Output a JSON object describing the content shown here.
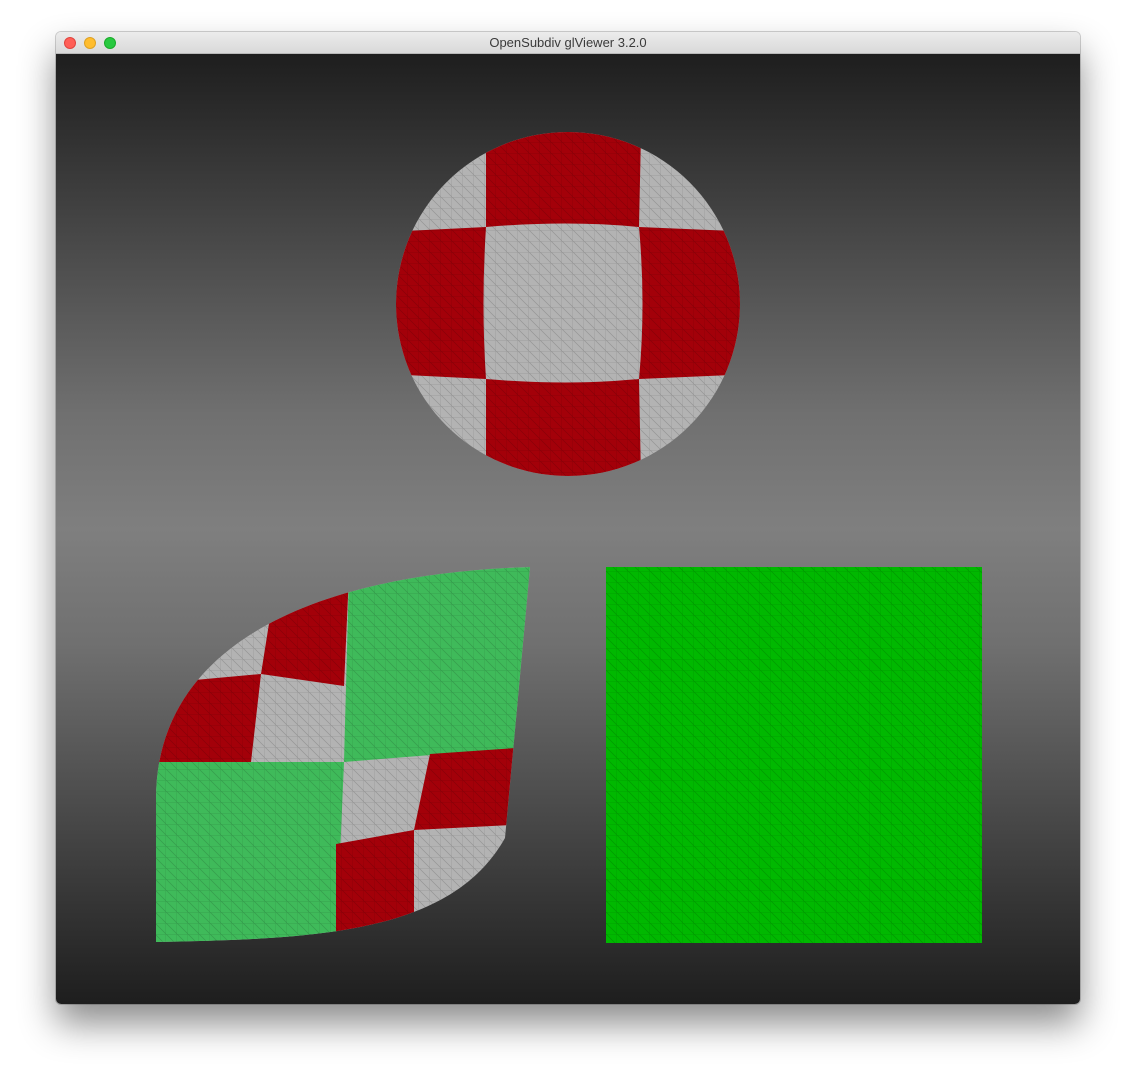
{
  "window": {
    "title": "OpenSubdiv glViewer 3.2.0",
    "buttons": [
      {
        "name": "close",
        "color": "#ff5f57"
      },
      {
        "name": "minimize",
        "color": "#ffbd2e"
      },
      {
        "name": "zoom",
        "color": "#28c940"
      }
    ]
  },
  "viewport": {
    "background_top": "#1e1e1e",
    "background_center": "#7f7f7f",
    "models": [
      {
        "name": "sphere-mesh",
        "pattern": "checkerboard",
        "colors": [
          "#a30009",
          "#b3b3b3"
        ]
      },
      {
        "name": "warped-plane-mesh",
        "pattern": "checkerboard",
        "colors": [
          "#a30009",
          "#b3b3b3",
          "#3fba5a"
        ]
      },
      {
        "name": "flat-plane-mesh",
        "pattern": "solid",
        "colors": [
          "#00b800"
        ]
      }
    ],
    "wireframe_color": "#000000"
  }
}
